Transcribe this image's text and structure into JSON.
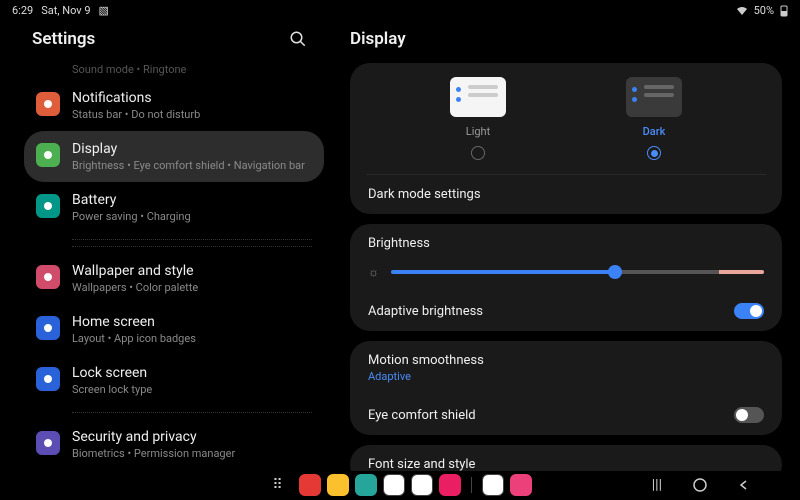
{
  "status": {
    "time": "6:29",
    "date": "Sat, Nov 9",
    "battery": "50%"
  },
  "leftPane": {
    "title": "Settings",
    "truncatedPrev": "Sound mode  •  Ringtone",
    "items": [
      {
        "title": "Notifications",
        "sub": "Status bar  •  Do not disturb",
        "iconColor": "#e05d3b"
      },
      {
        "title": "Display",
        "sub": "Brightness  •  Eye comfort shield  •  Navigation bar",
        "iconColor": "#4caf50",
        "selected": true
      },
      {
        "title": "Battery",
        "sub": "Power saving  •  Charging",
        "iconColor": "#009688"
      },
      {
        "title": "Wallpaper and style",
        "sub": "Wallpapers  •  Color palette",
        "iconColor": "#d14b6a"
      },
      {
        "title": "Home screen",
        "sub": "Layout  •  App icon badges",
        "iconColor": "#2962d9"
      },
      {
        "title": "Lock screen",
        "sub": "Screen lock type",
        "iconColor": "#2962d9"
      },
      {
        "title": "Security and privacy",
        "sub": "Biometrics  •  Permission manager",
        "iconColor": "#5b4db3"
      }
    ]
  },
  "rightPane": {
    "title": "Display",
    "themes": {
      "light": "Light",
      "dark": "Dark",
      "selected": "dark"
    },
    "darkModeSettings": "Dark mode settings",
    "brightness": {
      "label": "Brightness"
    },
    "adaptiveBrightness": {
      "label": "Adaptive brightness",
      "on": true
    },
    "motionSmoothness": {
      "label": "Motion smoothness",
      "value": "Adaptive"
    },
    "eyeComfort": {
      "label": "Eye comfort shield",
      "on": false
    },
    "fontSize": {
      "label": "Font size and style"
    }
  },
  "dock": {
    "apps": [
      {
        "c": "#e53935"
      },
      {
        "c": "#fbc02d"
      },
      {
        "c": "#26a69a"
      },
      {
        "c": "#fff"
      },
      {
        "c": "#fff"
      },
      {
        "c": "#e91e63"
      },
      {
        "c": "#fff"
      },
      {
        "c": "#ec407a"
      }
    ]
  }
}
